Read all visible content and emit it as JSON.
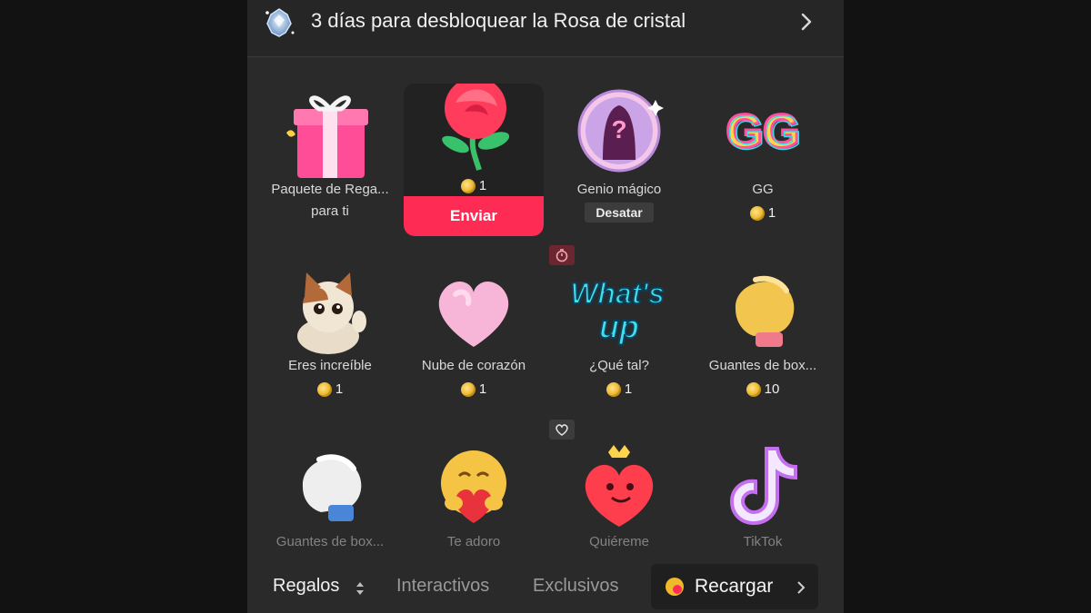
{
  "banner": {
    "text": "3 días para desbloquear la Rosa de cristal",
    "icon": "crystal-rose-icon",
    "arrow_icon": "chevron-right-icon"
  },
  "gifts": [
    {
      "name": "Paquete de Rega...",
      "name2": "para ti",
      "icon": "gift-box-icon"
    },
    {
      "name": "",
      "price": "1",
      "icon": "rose-icon",
      "selected": true,
      "send_label": "Enviar"
    },
    {
      "name": "Genio mágico",
      "tag": "Desatar",
      "icon": "magic-genie-icon"
    },
    {
      "name": "GG",
      "price": "1",
      "icon": "gg-icon"
    },
    {
      "name": "Eres increíble",
      "price": "1",
      "icon": "cat-thumbs-up-icon"
    },
    {
      "name": "Nube de corazón",
      "price": "1",
      "icon": "heart-cloud-icon"
    },
    {
      "name": "¿Qué tal?",
      "price": "1",
      "icon": "whats-up-icon",
      "badge": "timer-icon"
    },
    {
      "name": "Guantes de box...",
      "price": "10",
      "icon": "boxing-glove-gold-icon"
    },
    {
      "name": "Guantes de box...",
      "icon": "boxing-glove-white-icon"
    },
    {
      "name": "Te adoro",
      "icon": "hug-heart-icon"
    },
    {
      "name": "Quiéreme",
      "icon": "love-me-heart-icon",
      "badge": "heart-badge-icon"
    },
    {
      "name": "TikTok",
      "icon": "tiktok-logo-icon"
    }
  ],
  "bottom": {
    "tabs": [
      "Regalos",
      "Interactivos",
      "Exclusivos"
    ],
    "recharge_label": "Recargar"
  },
  "colors": {
    "accent": "#fe2c55",
    "background": "#2a2a2a",
    "coin": "#e7a913"
  }
}
